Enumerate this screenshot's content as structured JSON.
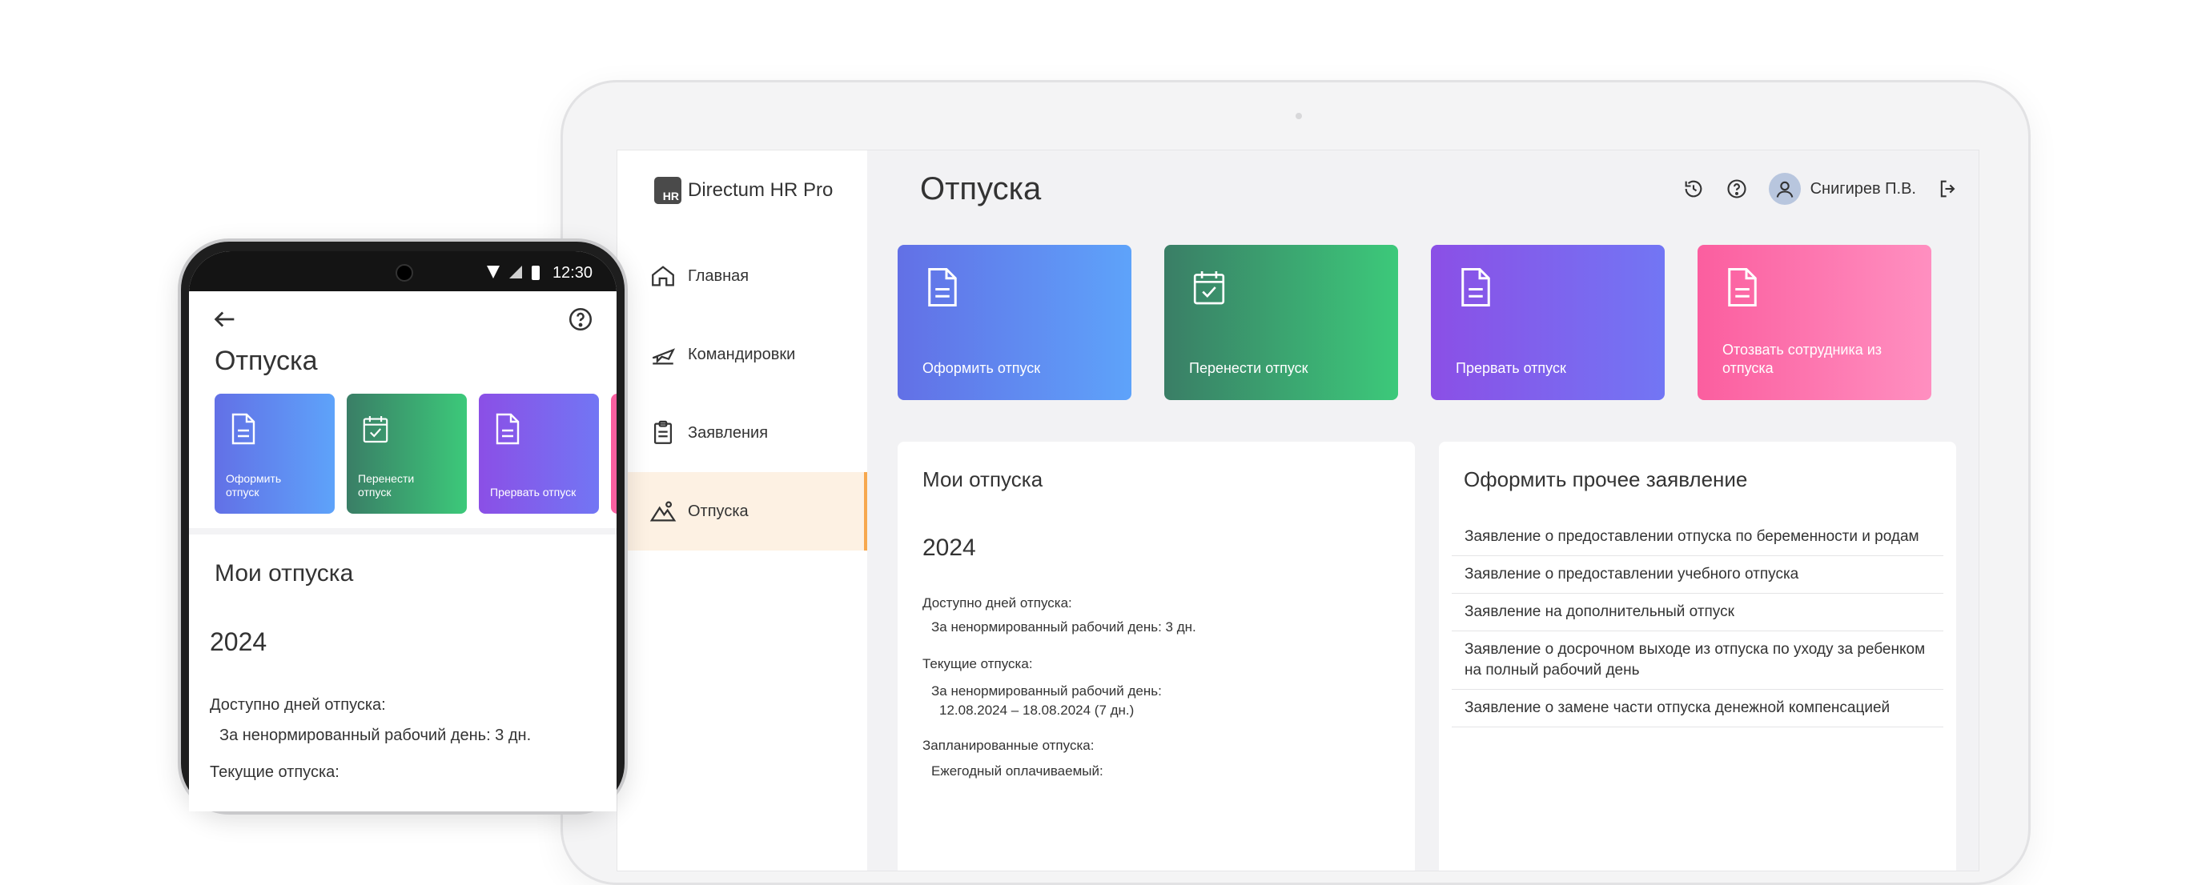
{
  "tablet": {
    "app_name": "Directum HR Pro",
    "logo_text": "HR",
    "nav": [
      {
        "label": "Главная",
        "icon": "home-icon"
      },
      {
        "label": "Командировки",
        "icon": "plane-icon"
      },
      {
        "label": "Заявления",
        "icon": "clipboard-icon"
      },
      {
        "label": "Отпуска",
        "icon": "mountain-icon",
        "active": true
      }
    ],
    "page_title": "Отпуска",
    "user_name": "Снигирев П.В.",
    "tiles": [
      {
        "label": "Оформить отпуск",
        "icon": "document-icon"
      },
      {
        "label": "Перенести отпуск",
        "icon": "calendar-check-icon"
      },
      {
        "label": "Прервать отпуск",
        "icon": "document-icon"
      },
      {
        "label": "Отозвать сотрудника из отпуска",
        "icon": "document-icon"
      }
    ],
    "my_vacations": {
      "title": "Мои отпуска",
      "year": "2024",
      "available_label": "Доступно дней отпуска:",
      "available_value": "За ненормированный рабочий день: 3 дн.",
      "current_label": "Текущие отпуска:",
      "current_type": "За ненормированный рабочий день:",
      "current_dates": "12.08.2024 – 18.08.2024 (7 дн.)",
      "planned_label": "Запланированные отпуска:",
      "planned_type": "Ежегодный оплачиваемый:"
    },
    "other": {
      "title": "Оформить прочее заявление",
      "items": [
        "Заявление о предоставлении отпуска по беременности и родам",
        "Заявление о предоставлении учебного отпуска",
        "Заявление на дополнительный отпуск",
        "Заявление о досрочном выходе из отпуска по уходу за ребенком на полный рабочий день",
        "Заявление о замене части отпуска денежной компенсацией"
      ]
    }
  },
  "phone": {
    "time": "12:30",
    "title": "Отпуска",
    "tiles": [
      {
        "label": "Оформить отпуск"
      },
      {
        "label": "Перенести отпуск"
      },
      {
        "label": "Прервать отпуск"
      }
    ],
    "my_vacations": {
      "title": "Мои отпуска",
      "year": "2024",
      "available_label": "Доступно дней отпуска:",
      "available_value": "За ненормированный рабочий день: 3 дн.",
      "current_label": "Текущие отпуска:"
    }
  }
}
